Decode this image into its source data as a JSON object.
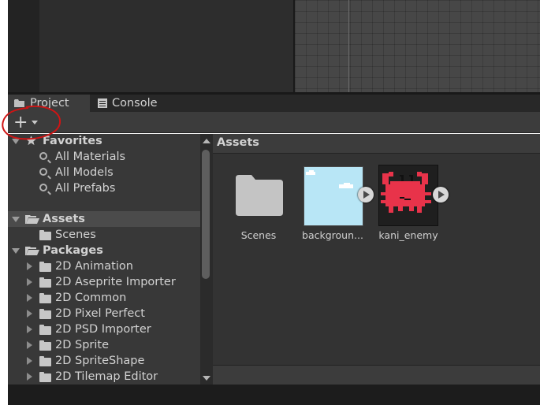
{
  "tabs": [
    {
      "label": "Project",
      "icon": "folder-icon",
      "active": true
    },
    {
      "label": "Console",
      "icon": "console-icon",
      "active": false
    }
  ],
  "toolbar": {
    "add_icon": "plus-icon",
    "add_label": "+"
  },
  "tree": {
    "favorites": {
      "label": "Favorites",
      "items": [
        "All Materials",
        "All Models",
        "All Prefabs"
      ]
    },
    "assets": {
      "label": "Assets",
      "children": [
        "Scenes"
      ]
    },
    "packages": {
      "label": "Packages",
      "children": [
        "2D Animation",
        "2D Aseprite Importer",
        "2D Common",
        "2D Pixel Perfect",
        "2D PSD Importer",
        "2D Sprite",
        "2D SpriteShape",
        "2D Tilemap Editor"
      ]
    }
  },
  "assets_panel": {
    "title": "Assets",
    "items": [
      {
        "label": "Scenes",
        "type": "folder"
      },
      {
        "label": "backgroun...",
        "type": "sprite"
      },
      {
        "label": "kani_enemy",
        "type": "sprite"
      }
    ]
  },
  "colors": {
    "panel_bg": "#383838",
    "accent_annotation": "#d01414",
    "sprite_crab": "#e8334a",
    "sprite_sky": "#b8e6f6"
  }
}
